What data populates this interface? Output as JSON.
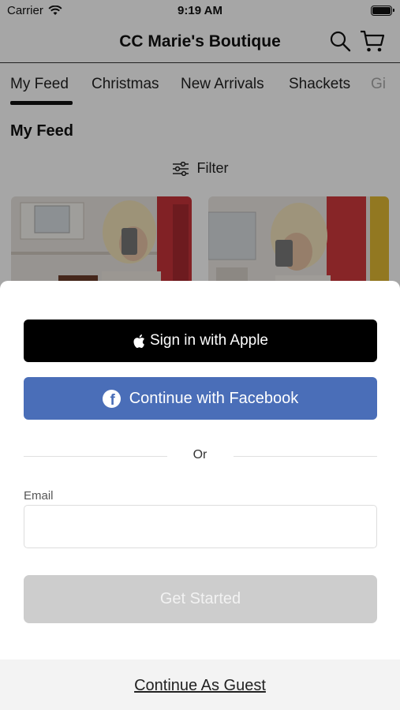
{
  "status_bar": {
    "carrier": "Carrier",
    "time": "9:19 AM"
  },
  "nav": {
    "title": "CC Marie's Boutique"
  },
  "tabs": [
    {
      "label": "My Feed"
    },
    {
      "label": "Christmas"
    },
    {
      "label": "New Arrivals"
    },
    {
      "label": "Shackets"
    },
    {
      "label": "Gi"
    }
  ],
  "feed": {
    "title": "My Feed",
    "filter_label": "Filter"
  },
  "sheet": {
    "apple_label": "Sign in with Apple",
    "facebook_label": "Continue with Facebook",
    "or_label": "Or",
    "email_label": "Email",
    "email_value": "",
    "start_label": "Get Started",
    "guest_label": "Continue As Guest"
  },
  "colors": {
    "facebook": "#4a6eb8",
    "apple": "#000000",
    "start_disabled": "#cdcdcd"
  }
}
